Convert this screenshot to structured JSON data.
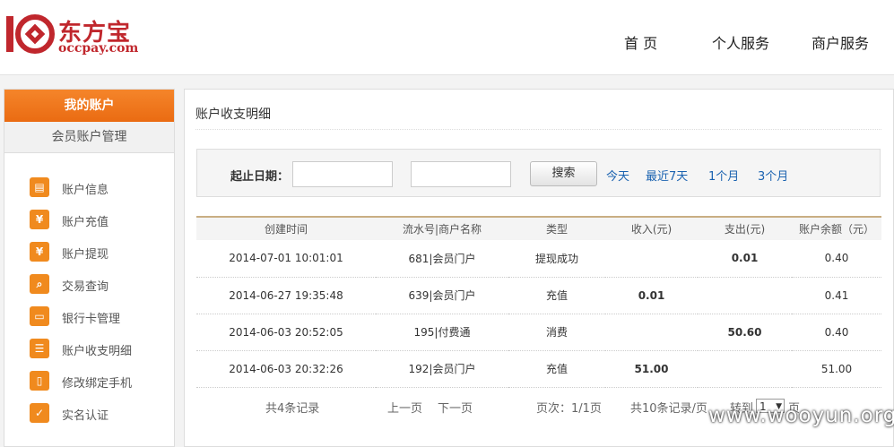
{
  "header": {
    "logo_cn": "东方宝",
    "logo_en": "occpay.com",
    "nav": [
      "首 页",
      "个人服务",
      "商户服务"
    ]
  },
  "sidebar": {
    "title": "我的账户",
    "subtitle": "会员账户管理",
    "items": [
      {
        "label": "账户信息",
        "icon": "id-card-icon",
        "glyph": "▤"
      },
      {
        "label": "账户充值",
        "icon": "yen-icon",
        "glyph": "¥"
      },
      {
        "label": "账户提现",
        "icon": "withdraw-icon",
        "glyph": "¥"
      },
      {
        "label": "交易查询",
        "icon": "magnifier-icon",
        "glyph": "⌕"
      },
      {
        "label": "银行卡管理",
        "icon": "bank-card-icon",
        "glyph": "▭"
      },
      {
        "label": "账户收支明细",
        "icon": "list-icon",
        "glyph": "☰"
      },
      {
        "label": "修改绑定手机",
        "icon": "phone-icon",
        "glyph": "▯"
      },
      {
        "label": "实名认证",
        "icon": "verify-icon",
        "glyph": "✓"
      }
    ]
  },
  "main": {
    "title": "账户收支明细",
    "search": {
      "label": "起止日期：",
      "button": "搜索",
      "quick": [
        "今天",
        "最近7天",
        "1个月",
        "3个月"
      ]
    },
    "table": {
      "headers": [
        "创建时间",
        "流水号|商户名称",
        "类型",
        "收入(元)",
        "支出(元)",
        "账户余额（元）"
      ],
      "rows": [
        {
          "time": "2014-07-01 10:01:01",
          "serial": "681|会员门户",
          "type": "提现成功",
          "income": "",
          "expense": "0.01",
          "balance": "0.40"
        },
        {
          "time": "2014-06-27 19:35:48",
          "serial": "639|会员门户",
          "type": "充值",
          "income": "0.01",
          "expense": "",
          "balance": "0.41"
        },
        {
          "time": "2014-06-03 20:52:05",
          "serial": "195|付费通",
          "type": "消费",
          "income": "",
          "expense": "50.60",
          "balance": "0.40"
        },
        {
          "time": "2014-06-03 20:32:26",
          "serial": "192|会员门户",
          "type": "充值",
          "income": "51.00",
          "expense": "",
          "balance": "51.00"
        }
      ]
    },
    "pager": {
      "total": "共4条记录",
      "prev": "上一页",
      "next": "下一页",
      "page_info": "页次：1/1页",
      "per_page": "共10条记录/页",
      "goto_label": "转到",
      "goto_value": "1",
      "goto_suffix": "页"
    }
  },
  "watermark": "www.wooyun.org",
  "colors": {
    "accent": "#ea6b12",
    "brand_red": "#c0272d",
    "income": "#f07a16",
    "expense": "#59a329",
    "link": "#1a62b0"
  }
}
